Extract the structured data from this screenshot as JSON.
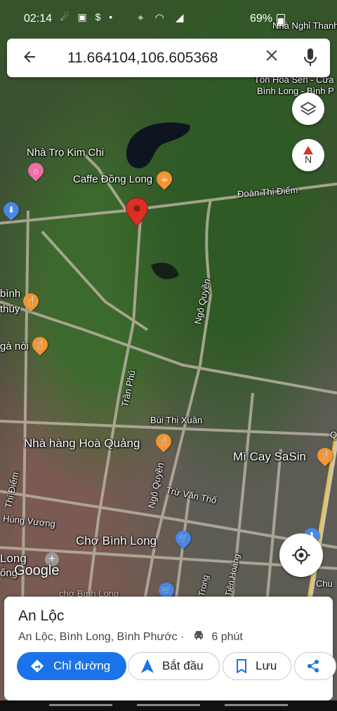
{
  "status_bar": {
    "time": "02:14",
    "battery": "69%",
    "icons": [
      "messenger-icon",
      "sim-icon",
      "currency-icon",
      "dot-icon",
      "location-icon",
      "wifi-icon",
      "signal-icon"
    ]
  },
  "search": {
    "query": "11.664104,106.605368"
  },
  "map": {
    "labels": {
      "nha_nghi": "Nhà Nghỉ Thanh",
      "hoa_sen_1": "Tôn Hoa Sen - Cửa",
      "hoa_sen_2": "Bình Long - Bình P",
      "nha_tro": "Nhà Trọ Kim Chi",
      "caffe": "Caffe Đồng Long",
      "doan_thi_diem": "Đoàn Thị Điểm",
      "binh": "bình",
      "thuy": "thúy",
      "ga_noi": "gà nòi",
      "ngo_quyen_1": "Ngô Quyền",
      "tran_phu": "Trần Phú",
      "bui_thi_xuan": "Bùi Thị Xuân",
      "nha_hang": "Nhà hàng Hoà Quảng",
      "mi_cay": "Mì Cay SaSin",
      "ngo_quyen_2": "Ngô Quyền",
      "thi_diem": "Thị Điểm",
      "tru_van_tho": "Trừ Văn Thố",
      "hung_vuong": "Hùng Vương",
      "cho_binh_long": "Chợ Bình Long",
      "long": "Long",
      "ong": "ống",
      "google": "Google",
      "tong": "Trong",
      "tien_hoang": "Tiên Hoàng",
      "chu": "Chu",
      "cho_binh_long_2": "chợ Bình Long",
      "q": "Q"
    },
    "compass_letter": "N"
  },
  "place": {
    "name": "An Lộc",
    "address": "An Lộc, Bình Long, Bình Phước",
    "separator": "·",
    "travel_time": "6 phút"
  },
  "actions": {
    "directions": "Chỉ đường",
    "start": "Bắt đầu",
    "save": "Lưu"
  },
  "colors": {
    "accent": "#1a73e8",
    "pin": "#d93025",
    "poi_food": "#f29534",
    "poi_shop": "#4a86e8",
    "poi_hotel": "#ec6fa3"
  }
}
